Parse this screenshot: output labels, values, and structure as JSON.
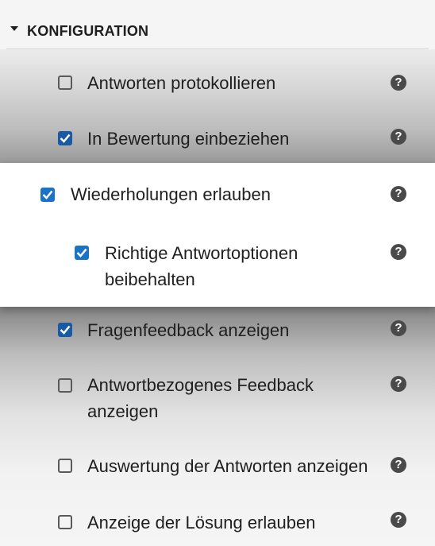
{
  "section": {
    "title": "KONFIGURATION"
  },
  "options": [
    {
      "label": "Antworten protokollieren",
      "checked": false
    },
    {
      "label": "In Bewertung einbeziehen",
      "checked": true
    },
    {
      "label": "Wiederholungen erlauben",
      "checked": true
    },
    {
      "label": "Richtige Antwortoptionen\nbeibehalten",
      "checked": true
    },
    {
      "label": "Fragenfeedback anzeigen",
      "checked": true
    },
    {
      "label": "Antwortbezogenes Feedback\nanzeigen",
      "checked": false
    },
    {
      "label": "Auswertung der Antworten anzeigen",
      "checked": false
    },
    {
      "label": "Anzeige der Lösung erlauben",
      "checked": false
    }
  ],
  "help_glyph": "?",
  "colors": {
    "checkbox_checked": "#1a73c7",
    "help_icon": "#4a4a4a"
  }
}
